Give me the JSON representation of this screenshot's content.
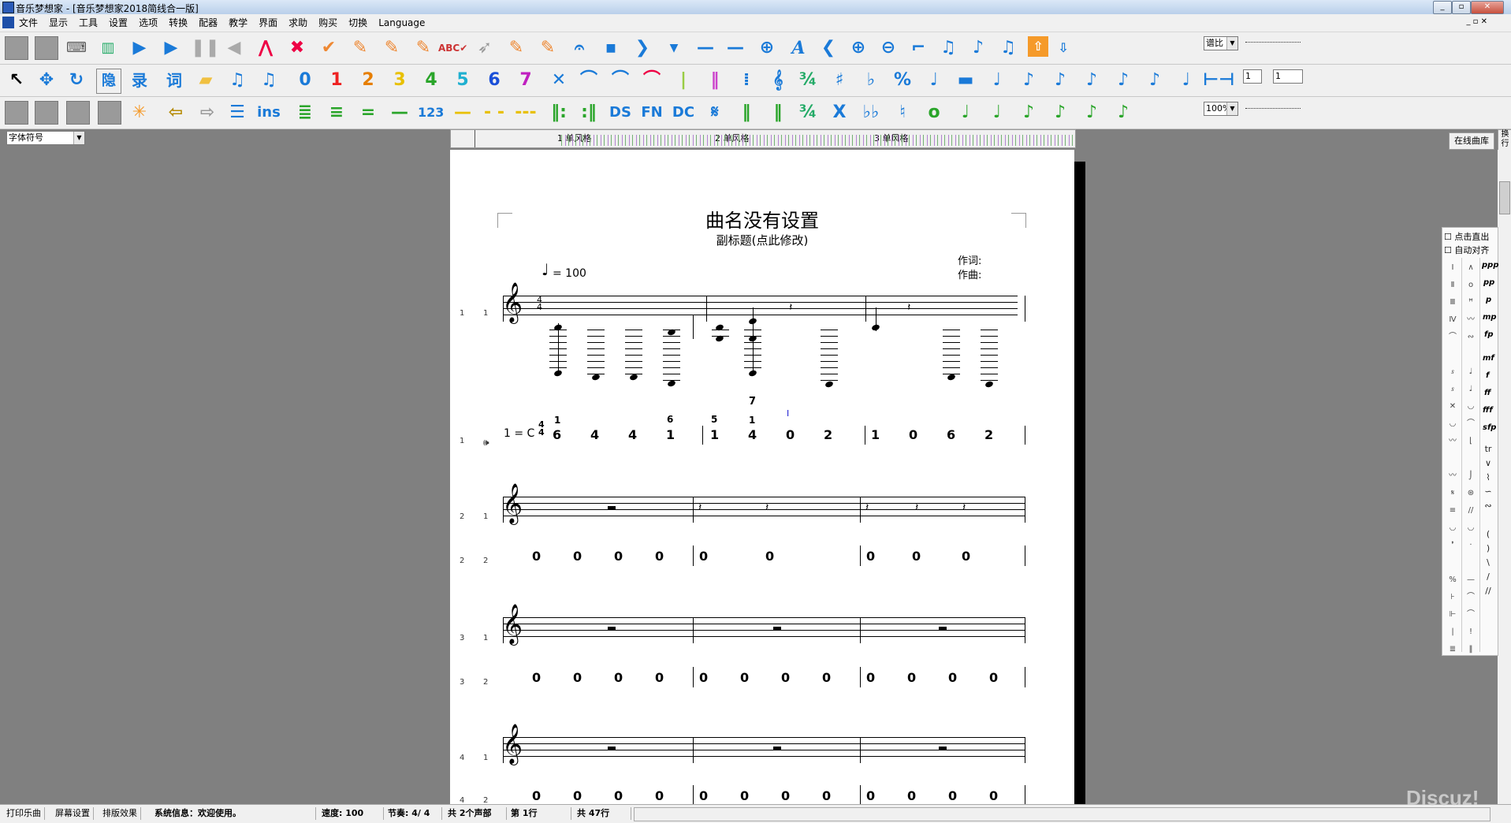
{
  "window": {
    "title": "音乐梦想家 - [音乐梦想家2018简线合一版]"
  },
  "menu": [
    "文件",
    "显示",
    "工具",
    "设置",
    "选项",
    "转换",
    "配器",
    "教学",
    "界面",
    "求助",
    "购买",
    "切换",
    "Language"
  ],
  "toolbar": {
    "font_select": "字体符号",
    "ratio_select": "谱比",
    "zoom_select": "100%",
    "field1": "1",
    "field2": "1",
    "ins_label": "ins",
    "num_label": "123",
    "ds_label": "DS",
    "fn_label": "FN",
    "dc_label": "DC",
    "rec_label": "录",
    "word_label": "词",
    "hide_label": "隐",
    "online_button": "在线曲库",
    "wrap_button": "换行"
  },
  "ruler": {
    "sections": [
      "1 单风格",
      "2 单风格",
      "3 单风格"
    ]
  },
  "score": {
    "title": "曲名没有设置",
    "subtitle": "副标题(点此修改)",
    "lyricist": "作词:",
    "composer": "作曲:",
    "tempo": "= 100",
    "key": "1 = C",
    "timesig_top": "4",
    "timesig_bottom": "4",
    "row_numbers": [
      [
        "1",
        "1"
      ],
      [
        "1",
        "1"
      ],
      [
        "2",
        "1"
      ],
      [
        "2",
        "2"
      ],
      [
        "3",
        "1"
      ],
      [
        "3",
        "2"
      ],
      [
        "4",
        "1"
      ],
      [
        "4",
        "2"
      ]
    ],
    "jianpu_row1": {
      "m1": [
        "6",
        "4",
        "4",
        "1"
      ],
      "m1_above": [
        "1",
        "",
        "",
        "6"
      ],
      "m2": [
        "1",
        "4",
        "0",
        "2"
      ],
      "m2_above": [
        "5",
        "1",
        "",
        ""
      ],
      "m2_top": "7",
      "m3": [
        "1",
        "0",
        "6",
        "2"
      ]
    },
    "jianpu_row2": {
      "m1": [
        "0",
        "0",
        "0",
        "0"
      ],
      "m2": [
        "0",
        "0"
      ],
      "m3": [
        "0",
        "0",
        "0"
      ]
    },
    "jianpu_row3": {
      "m1": [
        "0",
        "0",
        "0",
        "0"
      ],
      "m2": [
        "0",
        "0",
        "0",
        "0"
      ],
      "m3": [
        "0",
        "0",
        "0",
        "0"
      ]
    },
    "jianpu_row4": {
      "m1": [
        "0",
        "0",
        "0",
        "0"
      ],
      "m2": [
        "0",
        "0",
        "0",
        "0"
      ],
      "m3": [
        "0",
        "0",
        "0",
        "0"
      ]
    }
  },
  "right_panel": {
    "checkbox1": "点击直出",
    "checkbox2": "自动对齐",
    "dynamics": [
      "ppp",
      "pp",
      "p",
      "mp",
      "fp",
      "mf",
      "f",
      "ff",
      "fff",
      "sfp"
    ]
  },
  "status": {
    "print": "打印乐曲",
    "page_setup": "屏幕设置",
    "layout": "排版效果",
    "sysinfo": "系统信息：欢迎使用。",
    "speed": "速度: 100",
    "beat": "节奏: 4/ 4",
    "voices": "共 2个声部",
    "line": "第 1行",
    "total": "共 47行"
  },
  "watermark": "Discuz!"
}
